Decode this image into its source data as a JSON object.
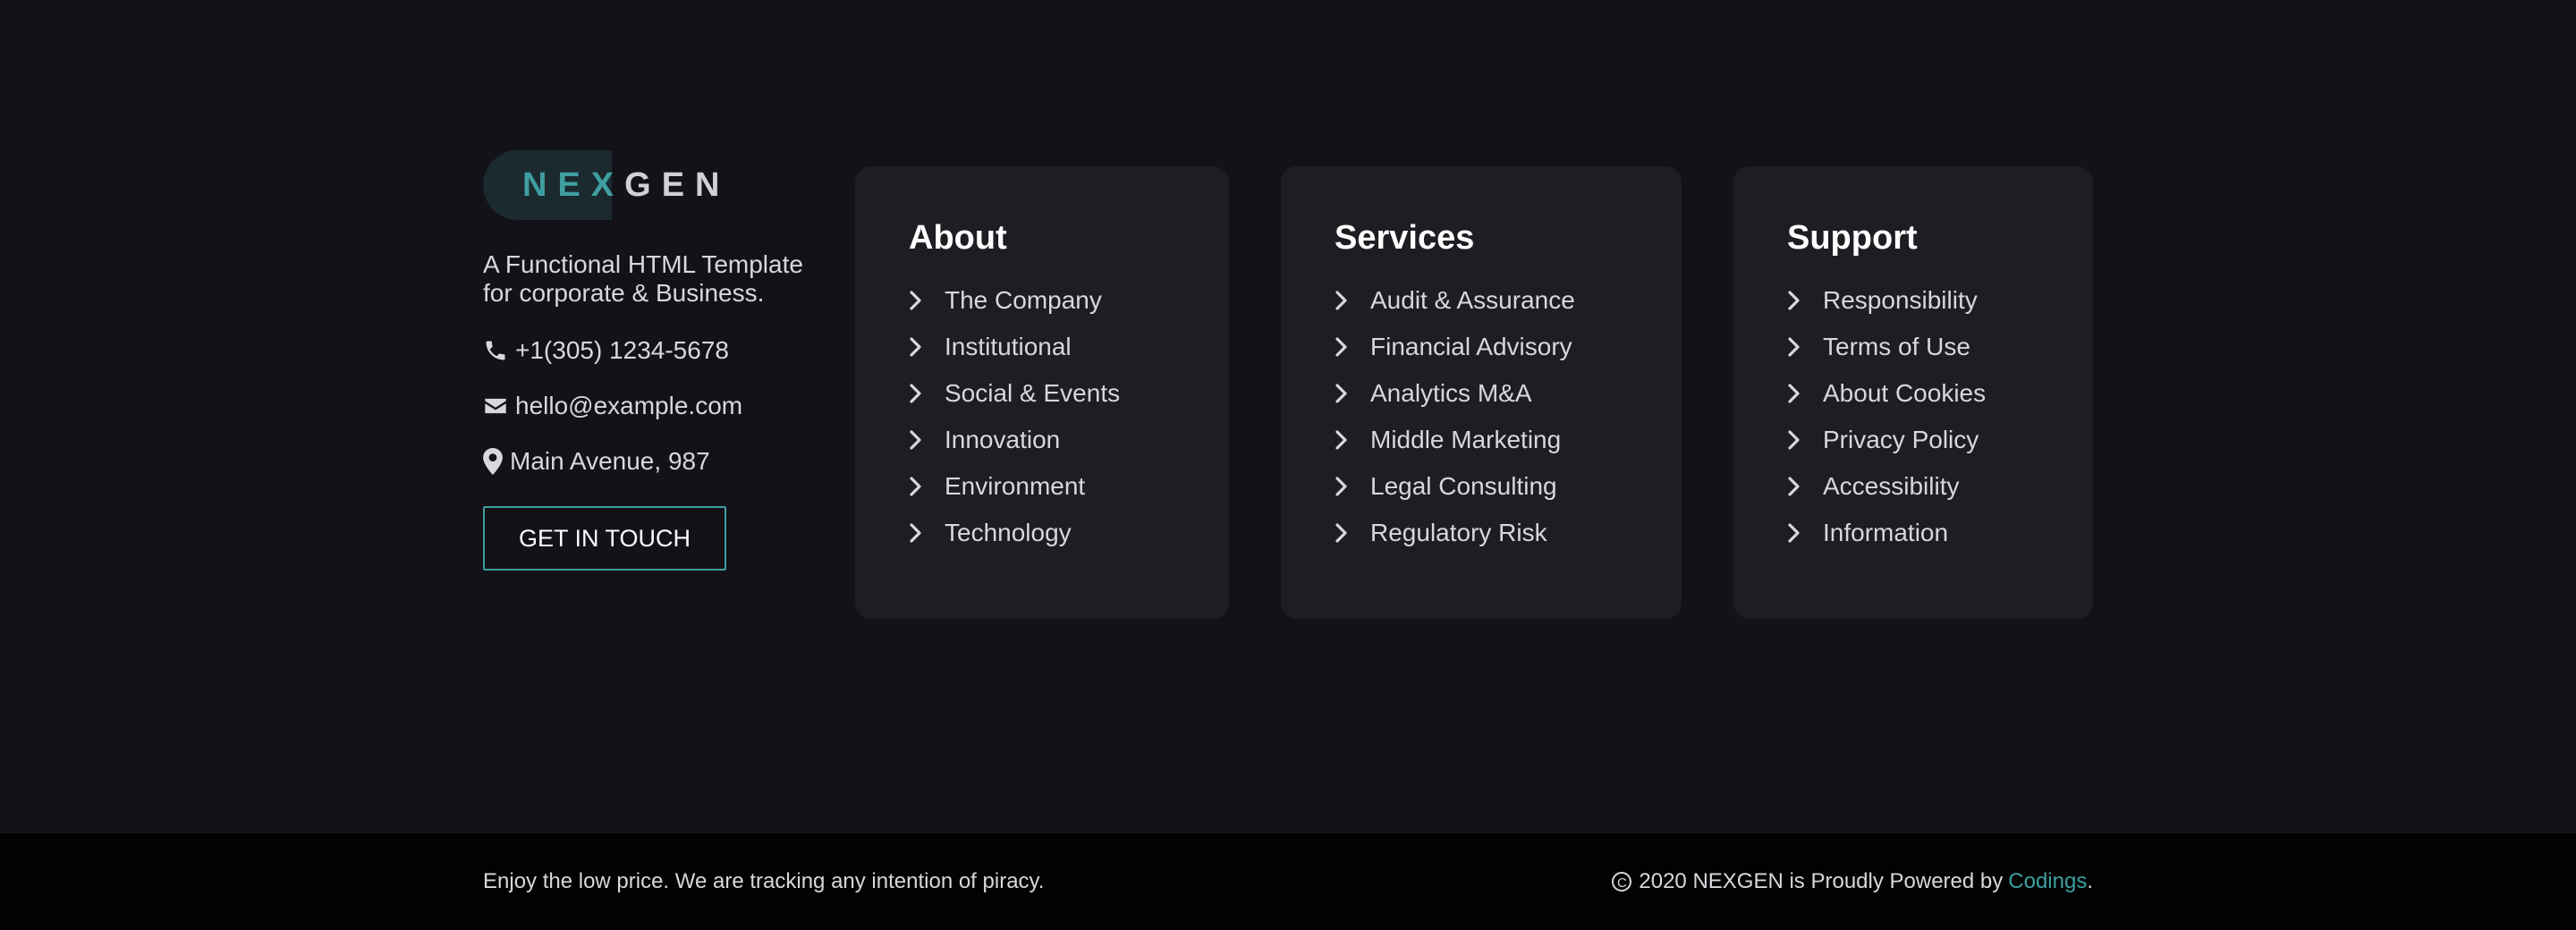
{
  "brand": {
    "logo_part1": "NEX",
    "logo_part2": "GEN",
    "tagline": "A Functional HTML Template for corporate & Business.",
    "phone": "+1(305) 1234-5678",
    "email": "hello@example.com",
    "address": "Main Avenue, 987",
    "cta_label": "GET IN TOUCH"
  },
  "columns": [
    {
      "title": "About",
      "links": [
        "The Company",
        "Institutional",
        "Social & Events",
        "Innovation",
        "Environment",
        "Technology"
      ]
    },
    {
      "title": "Services",
      "links": [
        "Audit & Assurance",
        "Financial Advisory",
        "Analytics M&A",
        "Middle Marketing",
        "Legal Consulting",
        "Regulatory Risk"
      ]
    },
    {
      "title": "Support",
      "links": [
        "Responsibility",
        "Terms of Use",
        "About Cookies",
        "Privacy Policy",
        "Accessibility",
        "Information"
      ]
    }
  ],
  "bottom": {
    "notice": "Enjoy the low price. We are tracking any intention of piracy.",
    "copyright_symbol": "C",
    "copyright_text": "2020 NEXGEN is Proudly Powered by",
    "powered_link": "Codings",
    "period": "."
  },
  "colors": {
    "accent": "#3f9ea1",
    "background": "#121218",
    "card": "#1d1d23",
    "bottom_bar": "#020203"
  },
  "icons": {
    "phone": "phone-icon",
    "email": "envelope-icon",
    "address": "map-marker-icon",
    "link": "chevron-right-icon"
  }
}
